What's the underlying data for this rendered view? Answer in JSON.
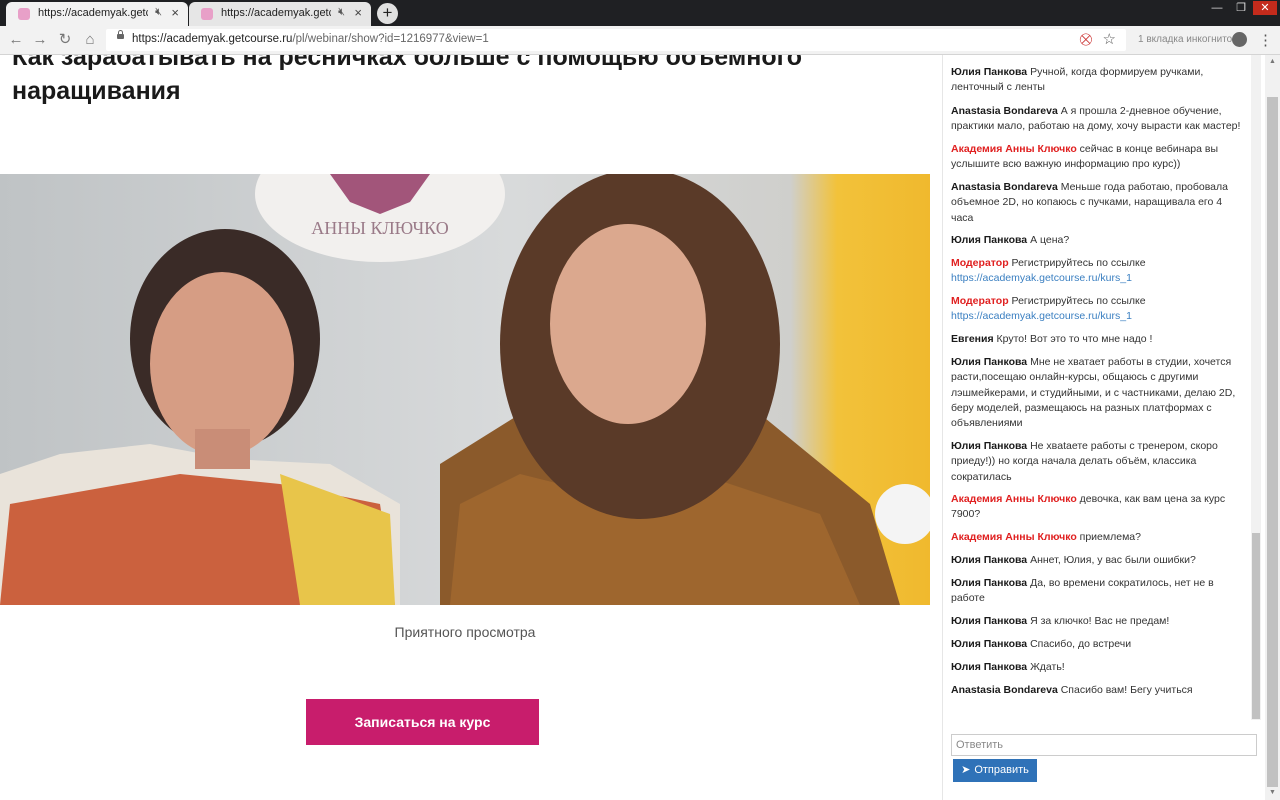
{
  "browser": {
    "tabs": [
      {
        "title": "https://academyak.getcourse"
      },
      {
        "title": "https://academyak.getcourse"
      }
    ],
    "new_tab_label": "+",
    "url_host": "https://academyak.getcourse.ru",
    "url_path": "/pl/webinar/show?id=1216977&view=1",
    "incognito_label": "1 вкладка инкогнито"
  },
  "page": {
    "title": "Как зарабатывать на ресничках больше с помощью объемного наращивания",
    "video_logo_text": "АННЫ КЛЮЧКО",
    "caption": "Приятного просмотра",
    "cta_label": "Записаться на курс"
  },
  "chat": {
    "messages": [
      {
        "author": "Юлия Панкова",
        "author_color": "#1a1a1a",
        "text": "Ручной, когда формируем ручками, ленточный с ленты"
      },
      {
        "author": "Anastasia Bondareva",
        "author_color": "#1a1a1a",
        "text": "А я прошла 2-дневное обучение, практики мало, работаю на дому, хочу вырасти как мастер!"
      },
      {
        "author": "Академия Анны Ключко",
        "author_color": "#e02020",
        "text": "сейчас в конце вебинара вы услышите всю важную информацию про курс))"
      },
      {
        "author": "Anastasia Bondareva",
        "author_color": "#1a1a1a",
        "text": "Меньше года работаю, пробовала объемное 2D, но копаюсь с пучками, наращивала его 4 часа"
      },
      {
        "author": "Юлия Панкова",
        "author_color": "#1a1a1a",
        "text": "А цена?"
      },
      {
        "author": "Модератор",
        "author_color": "#e02020",
        "text": "Регистрируйтесь по ссылке",
        "link": "https://academyak.getcourse.ru/kurs_1"
      },
      {
        "author": "Модератор",
        "author_color": "#e02020",
        "text": "Регистрируйтесь по ссылке",
        "link": "https://academyak.getcourse.ru/kurs_1"
      },
      {
        "author": "Евгения",
        "author_color": "#1a1a1a",
        "text": "Круто! Вот это то что мне надо !"
      },
      {
        "author": "Юлия Панкова",
        "author_color": "#1a1a1a",
        "text": "Мне не хватает работы в студии, хочется расти,посещаю онлайн-курсы, общаюсь с другими лэшмейкерами, и студийными, и с частниками, делаю 2D, беру моделей, размещаюсь на разных платформах с объявлениями"
      },
      {
        "author": "Юлия Панкова",
        "author_color": "#1a1a1a",
        "text": "Не хвatаете работы с тренером, скоро приеду!)) но когда начала делать объём, классика сократилась"
      },
      {
        "author": "Академия Анны Ключко",
        "author_color": "#e02020",
        "text": "девочка, как вам цена за курс 7900?"
      },
      {
        "author": "Академия Анны Ключко",
        "author_color": "#e02020",
        "text": "приемлема?"
      },
      {
        "author": "Юлия Панкова",
        "author_color": "#1a1a1a",
        "text": "Аннет, Юлия, у вас были ошибки?"
      },
      {
        "author": "Юлия Панкова",
        "author_color": "#1a1a1a",
        "text": "Да, во времени сократилось, нет не в работе"
      },
      {
        "author": "Юлия Панкова",
        "author_color": "#1a1a1a",
        "text": "Я за ключко! Вас не предам!"
      },
      {
        "author": "Юлия Панкова",
        "author_color": "#1a1a1a",
        "text": "Спасибо, до встречи"
      },
      {
        "author": "Юлия Панкова",
        "author_color": "#1a1a1a",
        "text": "Ждать!"
      },
      {
        "author": "Anastasia Bondareva",
        "author_color": "#1a1a1a",
        "text": "Спасибо вам! Бегу учиться"
      }
    ],
    "reply_placeholder": "Ответить",
    "send_label": "Отправить"
  },
  "icons": {
    "lock": "lock-icon",
    "star": "star-icon",
    "send": "paper-plane-icon"
  },
  "colors": {
    "cta": "#c81d6c",
    "send_button": "#2f72b8",
    "accent_author": "#e02020",
    "link": "#3a7fc1"
  }
}
